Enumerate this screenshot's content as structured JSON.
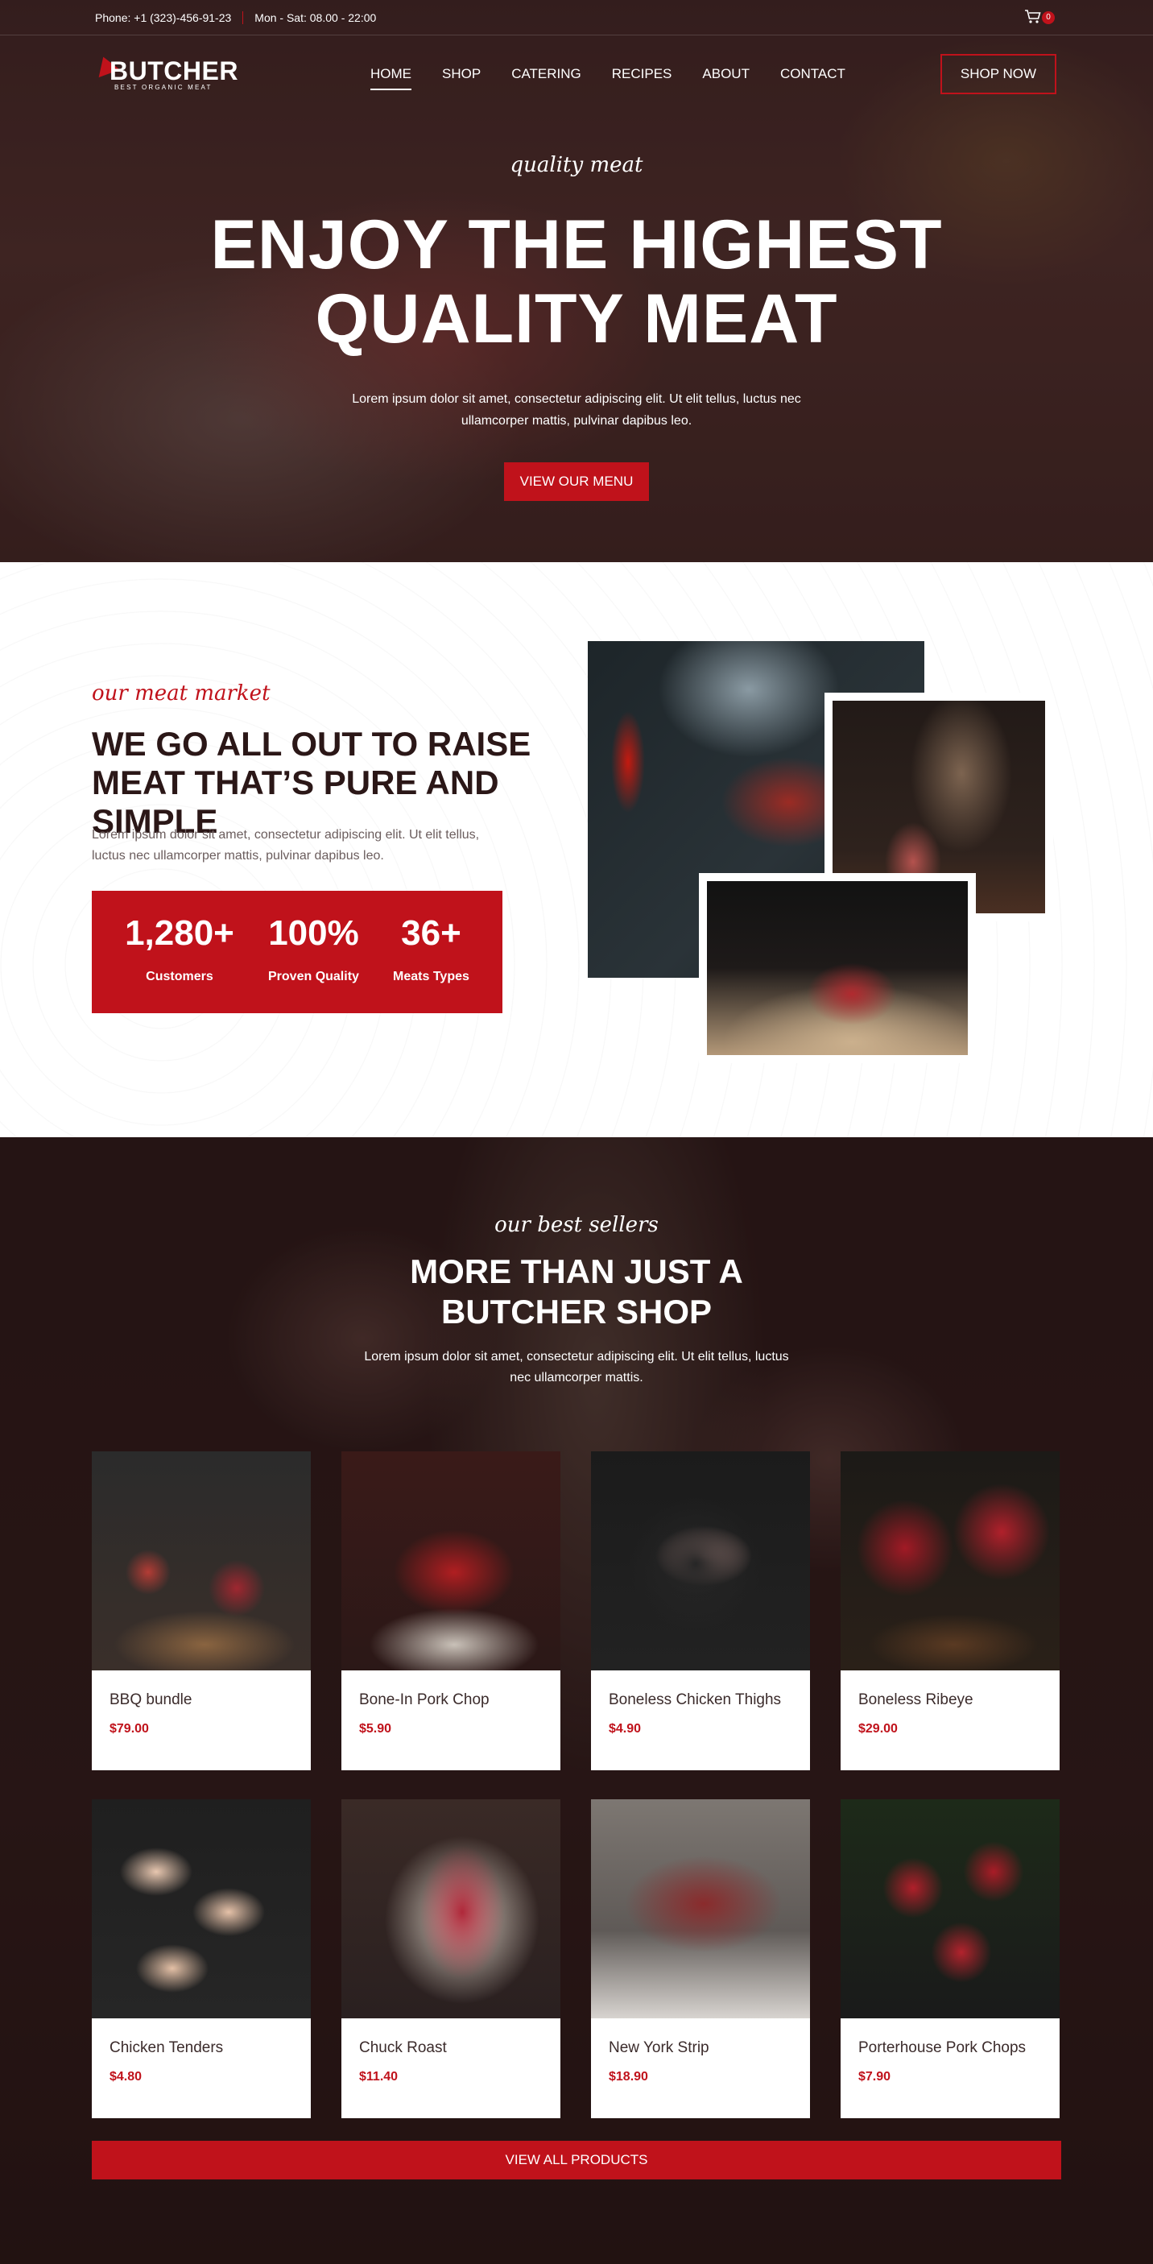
{
  "topbar": {
    "phone": "Phone: +1 (323)-456-91-23",
    "hours": "Mon - Sat: 08.00 - 22:00",
    "cart_count": "0"
  },
  "brand": {
    "name": "BUTCHER",
    "tagline": "BEST ORGANIC MEAT"
  },
  "nav": {
    "items": [
      "HOME",
      "SHOP",
      "CATERING",
      "RECIPES",
      "ABOUT",
      "CONTACT"
    ],
    "active": "HOME"
  },
  "header": {
    "cta": "SHOP NOW"
  },
  "hero": {
    "kicker": "quality meat",
    "title_line1": "ENJOY THE HIGHEST",
    "title_line2": "QUALITY MEAT",
    "text": "Lorem ipsum dolor sit amet, consectetur adipiscing elit. Ut elit tellus, luctus nec ullamcorper mattis, pulvinar dapibus leo.",
    "button": "VIEW OUR MENU"
  },
  "market": {
    "kicker": "our meat market",
    "title": "WE GO ALL OUT TO RAISE MEAT THAT’S PURE AND SIMPLE",
    "text": "Lorem ipsum dolor sit amet, consectetur adipiscing elit. Ut elit tellus, luctus nec ullamcorper mattis, pulvinar dapibus leo.",
    "stats": [
      {
        "value": "1,280+",
        "label": "Customers"
      },
      {
        "value": "100%",
        "label": "Proven Quality"
      },
      {
        "value": "36+",
        "label": "Meats Types"
      }
    ]
  },
  "sellers": {
    "kicker": "our best sellers",
    "title": "MORE THAN JUST A BUTCHER SHOP",
    "text": "Lorem ipsum dolor sit amet, consectetur adipiscing elit. Ut elit tellus, luctus nec ullamcorper mattis.",
    "products": [
      {
        "name": "BBQ bundle",
        "price": "$79.00"
      },
      {
        "name": "Bone-In Pork Chop",
        "price": "$5.90"
      },
      {
        "name": "Boneless Chicken Thighs",
        "price": "$4.90"
      },
      {
        "name": "Boneless Ribeye",
        "price": "$29.00"
      },
      {
        "name": "Chicken Tenders",
        "price": "$4.80"
      },
      {
        "name": "Chuck Roast",
        "price": "$11.40"
      },
      {
        "name": "New York Strip",
        "price": "$18.90"
      },
      {
        "name": "Porterhouse Pork Chops",
        "price": "$7.90"
      }
    ],
    "view_all": "VIEW ALL PRODUCTS"
  },
  "colors": {
    "accent": "#c0121b",
    "dark": "#2b1717"
  }
}
